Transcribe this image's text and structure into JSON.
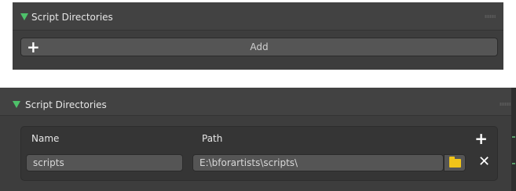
{
  "panel_collapsed": {
    "title": "Script Directories",
    "add_icon": "plus-icon",
    "add_label": "Add"
  },
  "panel_expanded": {
    "title": "Script Directories",
    "columns": {
      "name": "Name",
      "path": "Path"
    },
    "entries": [
      {
        "name": "scripts",
        "path": "E:\\bforartists\\scripts\\"
      }
    ],
    "icons": {
      "add": "plus-icon",
      "browse": "folder-icon",
      "remove": "close-icon"
    }
  },
  "colors": {
    "panel_bg": "#3d3d3d",
    "field_bg": "#555555",
    "disclosure_green": "#4ec16a",
    "folder_yellow": "#f0c419"
  }
}
